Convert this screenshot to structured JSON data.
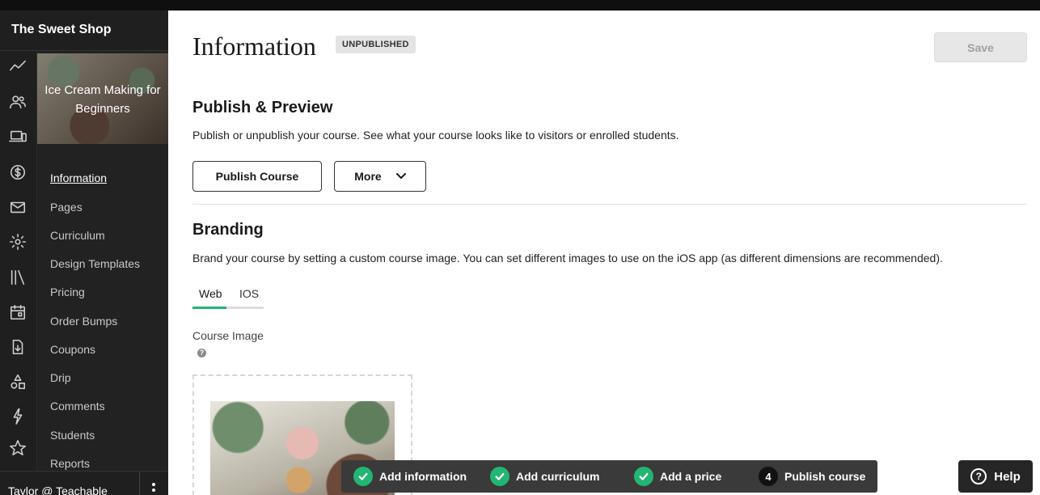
{
  "school_name": "The Sweet Shop",
  "course": {
    "title": "Ice Cream Making for Beginners"
  },
  "rail_icons": [
    "analytics-icon",
    "users-icon",
    "devices-icon",
    "dollar-icon",
    "mail-icon",
    "settings-icon",
    "library-icon",
    "calendar-icon",
    "download-icon",
    "shapes-icon",
    "lightning-icon",
    "star-icon"
  ],
  "nav": {
    "items": [
      "Information",
      "Pages",
      "Curriculum",
      "Design Templates",
      "Pricing",
      "Order Bumps",
      "Coupons",
      "Drip",
      "Comments",
      "Students",
      "Reports"
    ],
    "active": "Information"
  },
  "user": {
    "name": "Taylor @ Teachable"
  },
  "header": {
    "title": "Information",
    "status_badge": "UNPUBLISHED",
    "save_label": "Save"
  },
  "publish": {
    "heading": "Publish & Preview",
    "description": "Publish or unpublish your course. See what your course looks like to visitors or enrolled students.",
    "publish_button": "Publish Course",
    "more_button": "More"
  },
  "branding": {
    "heading": "Branding",
    "description": "Brand your course by setting a custom course image. You can set different images to use on the iOS app (as different dimensions are recommended).",
    "tabs": [
      "Web",
      "IOS"
    ],
    "active_tab": "Web",
    "course_image_label": "Course Image"
  },
  "checklist": {
    "steps": [
      {
        "label": "Add information",
        "done": true
      },
      {
        "label": "Add curriculum",
        "done": true
      },
      {
        "label": "Add a price",
        "done": true
      },
      {
        "label": "Publish course",
        "done": false,
        "number": "4"
      }
    ]
  },
  "help_label": "Help",
  "colors": {
    "accent_green": "#22b573",
    "sidebar_bg": "#222222"
  }
}
